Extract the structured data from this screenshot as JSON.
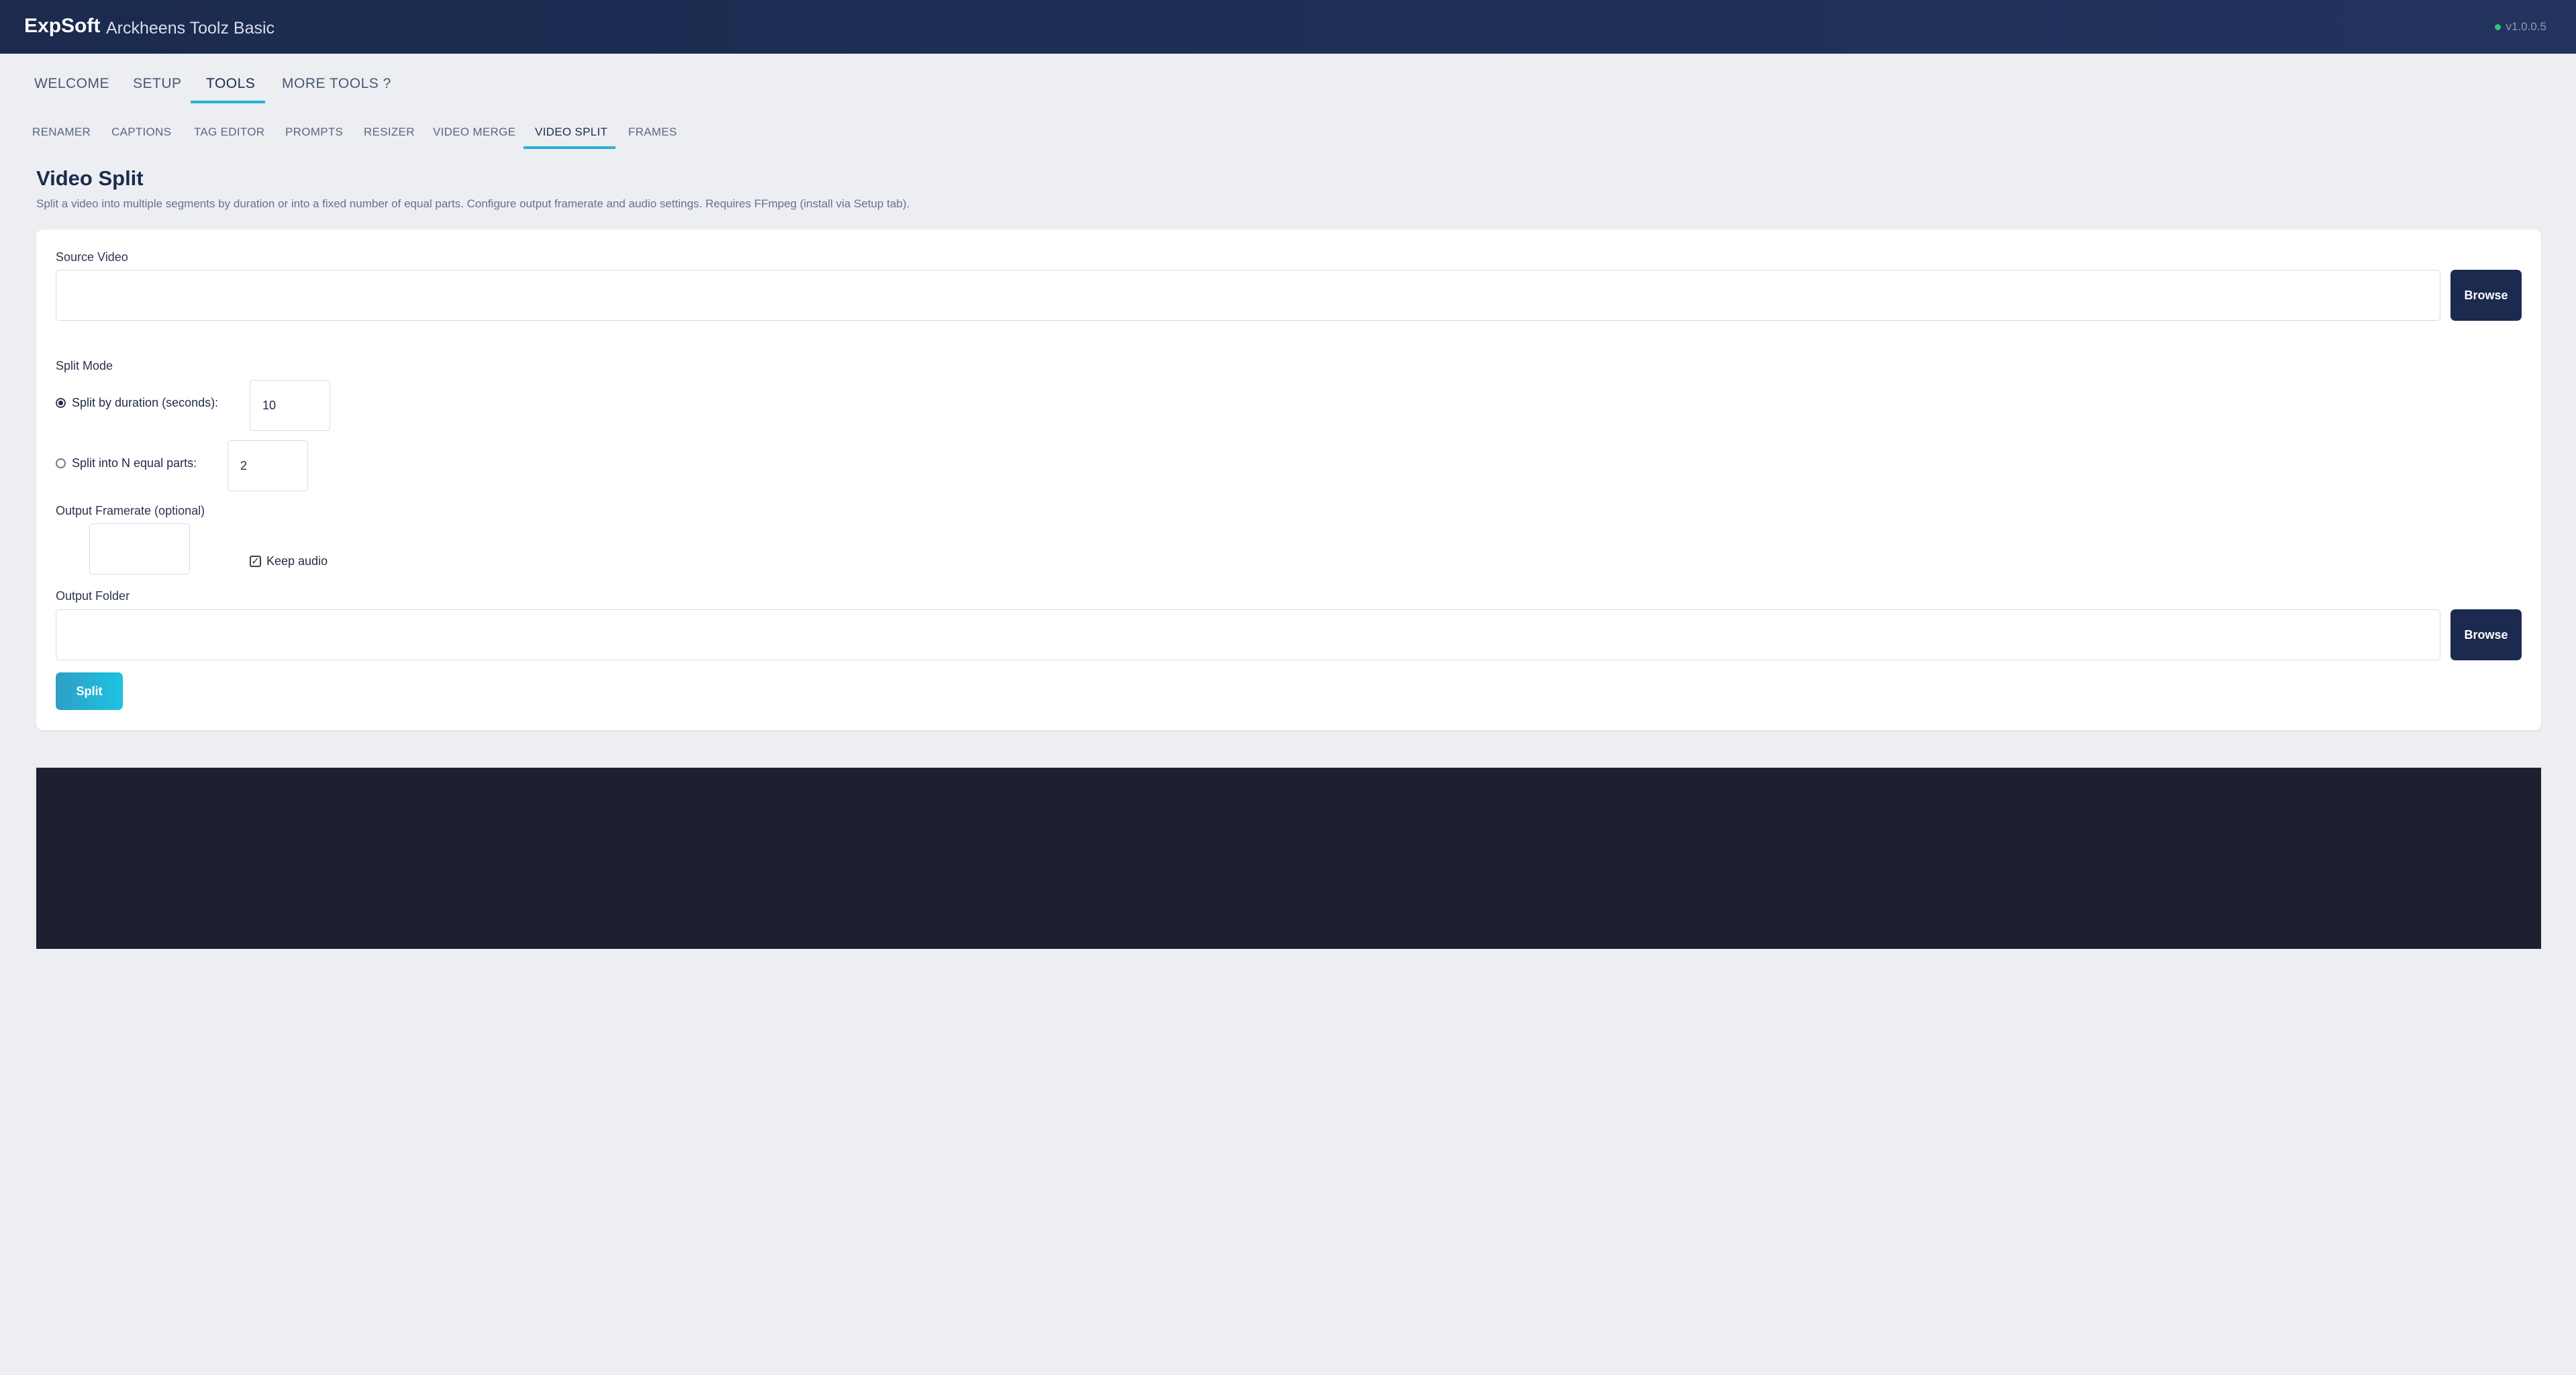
{
  "header": {
    "brand": "ExpSoft",
    "app_title": "Arckheens Toolz Basic",
    "version": "v1.0.0.5",
    "status_color": "#38c172"
  },
  "main_tabs": {
    "welcome": "WELCOME",
    "setup": "SETUP",
    "tools": "TOOLS",
    "more_tools": "MORE TOOLS ?",
    "active": "TOOLS"
  },
  "sub_tabs": {
    "renamer": "RENAMER",
    "captions": "CAPTIONS",
    "tag_editor": "TAG EDITOR",
    "prompts": "PROMPTS",
    "resizer": "RESIZER",
    "video_merge": "VIDEO MERGE",
    "video_split": "VIDEO SPLIT",
    "frames": "FRAMES",
    "active": "VIDEO SPLIT"
  },
  "page": {
    "title": "Video Split",
    "description": "Split a video into multiple segments by duration or into a fixed number of equal parts. Configure output framerate and audio settings. Requires FFmpeg (install via Setup tab)."
  },
  "form": {
    "source_video_label": "Source Video",
    "source_video_value": "",
    "browse_label": "Browse",
    "split_mode_label": "Split Mode",
    "split_by_duration_label": "Split by duration (seconds):",
    "split_by_duration_value": "10",
    "split_by_duration_checked": true,
    "split_into_parts_label": "Split into N equal parts:",
    "split_into_parts_value": "2",
    "split_into_parts_checked": false,
    "framerate_label": "Output Framerate (optional)",
    "framerate_value": "",
    "keep_audio_label": "Keep audio",
    "keep_audio_checked": true,
    "output_folder_label": "Output Folder",
    "output_folder_value": "",
    "output_browse_label": "Browse",
    "split_button_label": "Split"
  },
  "log": {
    "text": ""
  },
  "colors": {
    "header_bg": "#1b2a4e",
    "accent": "#26b3d4",
    "log_bg": "#1e1f30",
    "page_bg": "#eceef2"
  }
}
